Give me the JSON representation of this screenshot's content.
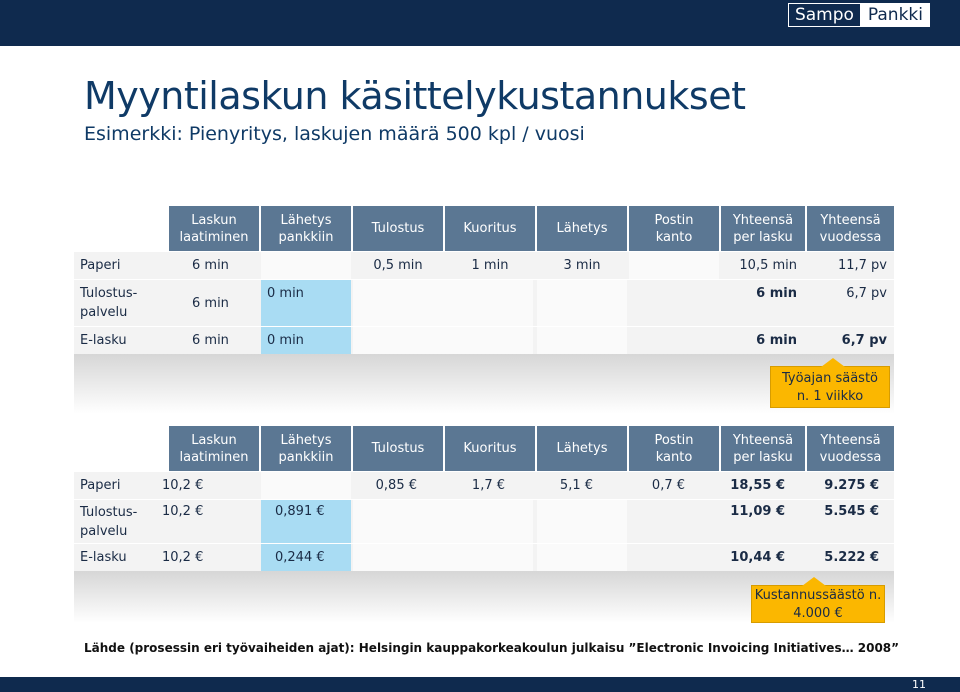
{
  "brand": {
    "part1": "Sampo",
    "part2": "Pankki"
  },
  "title": "Myyntilaskun käsittelykustannukset",
  "subtitle": "Esimerkki: Pienyritys, laskujen määrä 500 kpl / vuosi",
  "headers": [
    [
      "Laskun",
      "laatiminen"
    ],
    [
      "Lähetys",
      "pankkiin"
    ],
    [
      "Tulostus",
      ""
    ],
    [
      "Kuoritus",
      ""
    ],
    [
      "Lähetys",
      ""
    ],
    [
      "Postin",
      "kanto"
    ],
    [
      "Yhteensä",
      "per lasku"
    ],
    [
      "Yhteensä",
      "vuodessa"
    ]
  ],
  "table1": {
    "rows": [
      {
        "label": "Paperi",
        "laatiminen": "6 min",
        "lahetys_pankkiin": "",
        "tulostus": "0,5 min",
        "kuoritus": "1 min",
        "lahetys": "3 min",
        "postin_kanto": "",
        "per_lasku": "10,5 min",
        "vuodessa": "11,7 pv"
      },
      {
        "label": "Tulostus-palvelu",
        "laatiminen": "6 min",
        "lahetys_pankkiin": "0 min",
        "tulostus": "",
        "kuoritus": "",
        "lahetys": "",
        "postin_kanto": "",
        "per_lasku": "6 min",
        "vuodessa": "6,7 pv"
      },
      {
        "label": "E-lasku",
        "laatiminen": "6 min",
        "lahetys_pankkiin": "0 min",
        "tulostus": "",
        "kuoritus": "",
        "lahetys": "",
        "postin_kanto": "",
        "per_lasku": "6 min",
        "vuodessa": "6,7 pv"
      }
    ],
    "callout": [
      "Työajan säästö",
      "n. 1 viikko"
    ]
  },
  "table2": {
    "rows": [
      {
        "label": "Paperi",
        "laatiminen": "10,2 €",
        "lahetys_pankkiin": "",
        "tulostus": "0,85 €",
        "kuoritus": "1,7 €",
        "lahetys": "5,1 €",
        "postin_kanto": "0,7 €",
        "per_lasku": "18,55 €",
        "vuodessa": "9.275 €"
      },
      {
        "label": "Tulostus-palvelu",
        "laatiminen": "10,2 €",
        "lahetys_pankkiin": "0,891 €",
        "tulostus": "",
        "kuoritus": "",
        "lahetys": "",
        "postin_kanto": "",
        "per_lasku": "11,09 €",
        "vuodessa": "5.545 €"
      },
      {
        "label": "E-lasku",
        "laatiminen": "10,2 €",
        "lahetys_pankkiin": "0,244 €",
        "tulostus": "",
        "kuoritus": "",
        "lahetys": "",
        "postin_kanto": "",
        "per_lasku": "10,44 €",
        "vuodessa": "5.222 €"
      }
    ],
    "callout": [
      "Kustannussäästö n.",
      "4.000 €"
    ]
  },
  "source": "Lähde (prosessin eri työvaiheiden ajat): Helsingin kauppakorkeakoulun julkaisu ”Electronic Invoicing Initiatives… 2008”",
  "page_number": "11"
}
